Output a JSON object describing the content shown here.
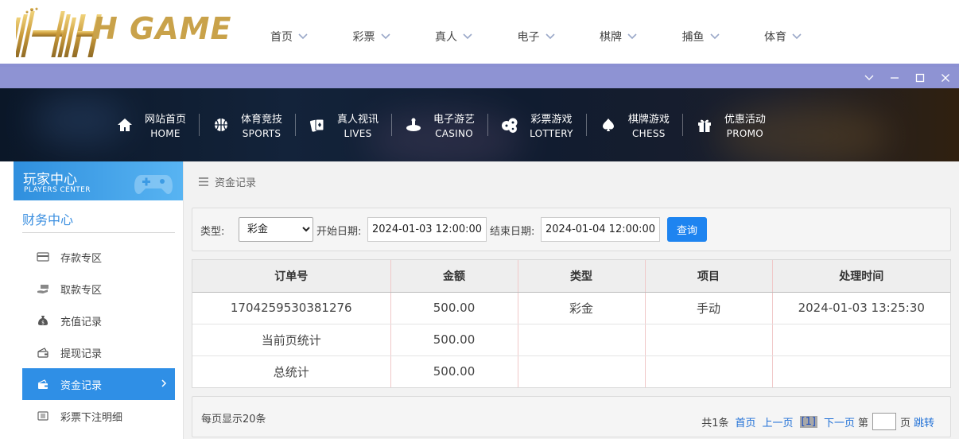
{
  "brand": {
    "logo_text": "H GAME",
    "accent": "#c9a24a"
  },
  "nav": [
    {
      "label": "首页"
    },
    {
      "label": "彩票"
    },
    {
      "label": "真人"
    },
    {
      "label": "电子"
    },
    {
      "label": "棋牌"
    },
    {
      "label": "捕鱼"
    },
    {
      "label": "体育"
    }
  ],
  "window": {
    "controls": [
      "chevron-down-icon",
      "minimize-icon",
      "maximize-icon",
      "close-icon"
    ]
  },
  "categories": [
    {
      "zh": "网站首页",
      "en": "HOME",
      "icon": "home-icon"
    },
    {
      "zh": "体育竞技",
      "en": "SPORTS",
      "icon": "basketball-icon"
    },
    {
      "zh": "真人视讯",
      "en": "LIVES",
      "icon": "cards-icon"
    },
    {
      "zh": "电子游艺",
      "en": "CASINO",
      "icon": "roulette-icon"
    },
    {
      "zh": "彩票游戏",
      "en": "LOTTERY",
      "icon": "dice-icon"
    },
    {
      "zh": "棋牌游戏",
      "en": "CHESS",
      "icon": "spade-icon"
    },
    {
      "zh": "优惠活动",
      "en": "PROMO",
      "icon": "gift-icon"
    }
  ],
  "sidebar": {
    "header_zh": "玩家中心",
    "header_en": "PLAYERS CENTER",
    "section": "财务中心",
    "items": [
      {
        "label": "存款专区",
        "icon": "card-icon"
      },
      {
        "label": "取款专区",
        "icon": "cash-hand-icon"
      },
      {
        "label": "充值记录",
        "icon": "money-bag-icon"
      },
      {
        "label": "提现记录",
        "icon": "wallet-icon"
      },
      {
        "label": "资金记录",
        "icon": "funds-icon",
        "active": true
      },
      {
        "label": "彩票下注明细",
        "icon": "list-icon"
      }
    ],
    "active_color": "#2f8fe6"
  },
  "breadcrumb": {
    "label": "资金记录"
  },
  "filter": {
    "type_label": "类型:",
    "type_value": "彩金",
    "start_label": "开始日期:",
    "start_value": "2024-01-03 12:00:00",
    "end_label": "结束日期:",
    "end_value": "2024-01-04 12:00:00",
    "query_label": "查询"
  },
  "table": {
    "headers": [
      "订单号",
      "金额",
      "类型",
      "项目",
      "处理时间"
    ],
    "rows": [
      [
        "1704259530381276",
        "500.00",
        "彩金",
        "手动",
        "2024-01-03 13:25:30"
      ],
      [
        "当前页统计",
        "500.00",
        "",
        "",
        ""
      ],
      [
        "总统计",
        "500.00",
        "",
        "",
        ""
      ]
    ]
  },
  "pager": {
    "per_page": "每页显示20条",
    "total": "共1条",
    "first": "首页",
    "prev": "上一页",
    "current": "[1]",
    "next": "下一页",
    "goto_prefix": "第",
    "goto_suffix": "页",
    "jump": "跳转"
  }
}
